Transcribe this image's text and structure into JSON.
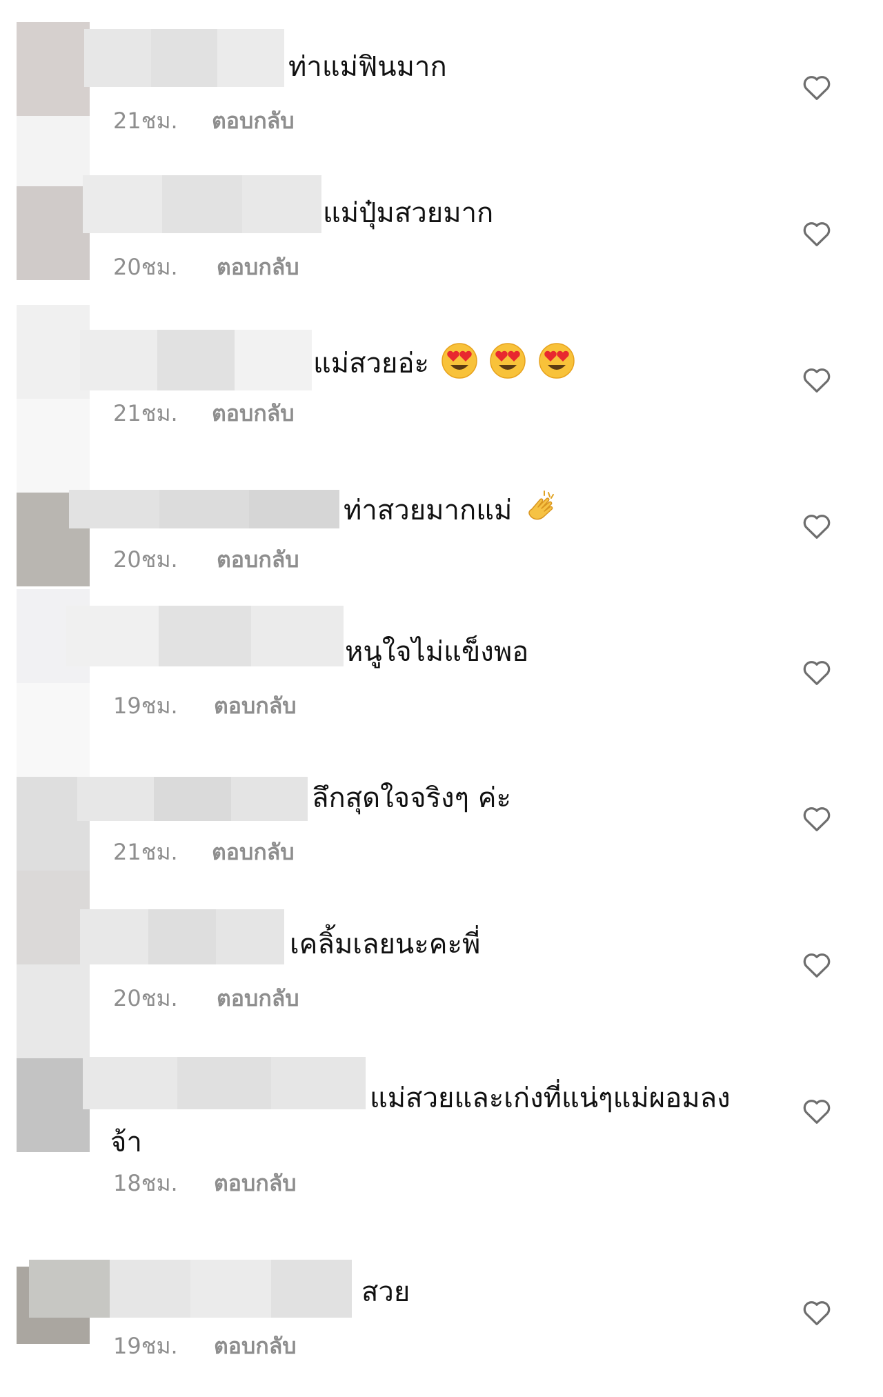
{
  "colors": {
    "text": "#111111",
    "meta": "#8e8e8e",
    "heart_outline": "#6e6e6e",
    "background": "#ffffff"
  },
  "comments": [
    {
      "text": "ท่าแม่ฟินมาก",
      "time": "21ชม.",
      "reply": "ตอบกลับ",
      "emojis": []
    },
    {
      "text": "แม่ปุ๋มสวยมาก",
      "time": "20ชม.",
      "reply": "ตอบกลับ",
      "emojis": []
    },
    {
      "text": "แม่สวยอ่ะ",
      "time": "21ชม.",
      "reply": "ตอบกลับ",
      "emojis": [
        "heart-eyes-emoji",
        "heart-eyes-emoji",
        "heart-eyes-emoji"
      ]
    },
    {
      "text": "ท่าสวยมากแม่",
      "time": "20ชม.",
      "reply": "ตอบกลับ",
      "emojis": [
        "clapping-hands-emoji"
      ]
    },
    {
      "text": "หนูใจไม่แข็งพอ",
      "time": "19ชม.",
      "reply": "ตอบกลับ",
      "emojis": []
    },
    {
      "text": "ลึกสุดใจจริงๆ ค่ะ",
      "time": "21ชม.",
      "reply": "ตอบกลับ",
      "emojis": []
    },
    {
      "text": "เคลิ้มเลยนะคะพี่",
      "time": "20ชม.",
      "reply": "ตอบกลับ",
      "emojis": []
    },
    {
      "text": "แม่สวยและเก่งที่แน่ๆแม่ผอมลงจ้า",
      "time": "18ชม.",
      "reply": "ตอบกลับ",
      "emojis": []
    },
    {
      "text": "สวย",
      "time": "19ชม.",
      "reply": "ตอบกลับ",
      "emojis": []
    }
  ]
}
